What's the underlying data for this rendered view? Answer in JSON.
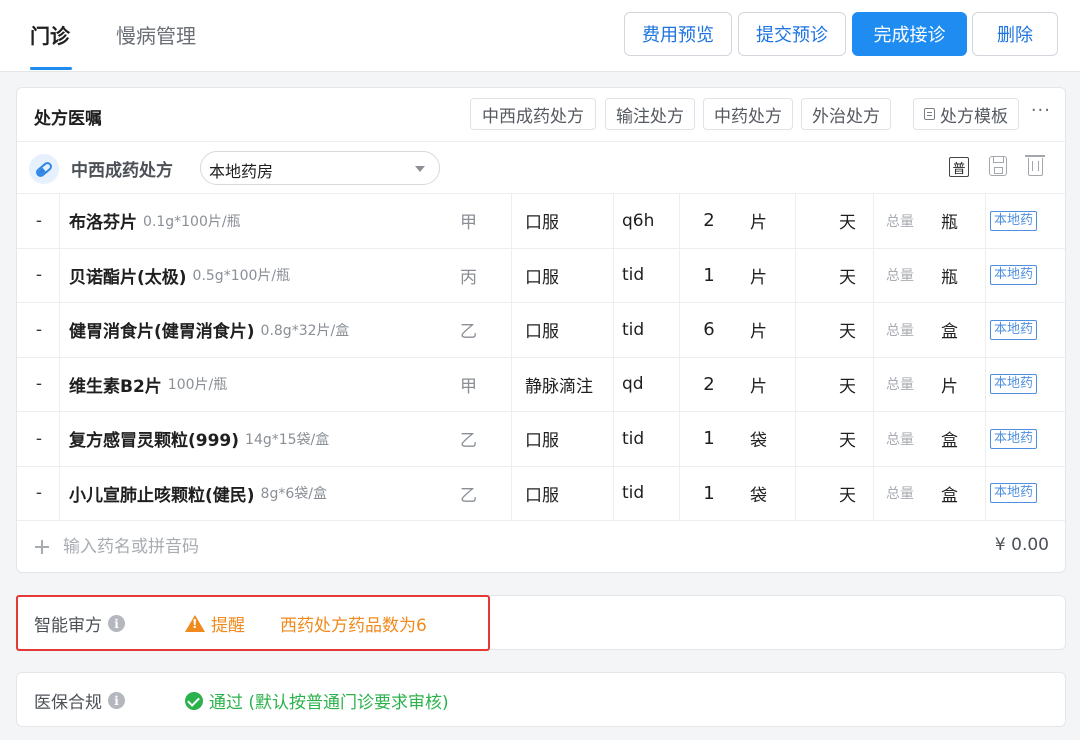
{
  "tabs": {
    "active": "门诊",
    "inactive": "慢病管理"
  },
  "toolbar": {
    "cost_preview": "费用预览",
    "submit_precheck": "提交预诊",
    "finish_visit": "完成接诊",
    "delete": "删除"
  },
  "rx": {
    "title": "处方医嘱",
    "types": [
      "中西成药处方",
      "输注处方",
      "中药处方",
      "外治处方"
    ],
    "template_label": "处方模板",
    "more": "···",
    "sub_title": "中西成药处方",
    "pharmacy": "本地药房",
    "pu_badge": "普",
    "rows": [
      {
        "dash": "-",
        "name": "布洛芬片",
        "spec": "0.1g*100片/瓶",
        "grade": "甲",
        "route": "口服",
        "freq": "q6h",
        "qty": "2",
        "unit": "片",
        "days": "天",
        "total": "总量",
        "pack": "瓶",
        "tag": "本地药"
      },
      {
        "dash": "-",
        "name": "贝诺酯片(太极)",
        "spec": "0.5g*100片/瓶",
        "grade": "丙",
        "route": "口服",
        "freq": "tid",
        "qty": "1",
        "unit": "片",
        "days": "天",
        "total": "总量",
        "pack": "瓶",
        "tag": "本地药"
      },
      {
        "dash": "-",
        "name": "健胃消食片(健胃消食片)",
        "spec": "0.8g*32片/盒",
        "grade": "乙",
        "route": "口服",
        "freq": "tid",
        "qty": "6",
        "unit": "片",
        "days": "天",
        "total": "总量",
        "pack": "盒",
        "tag": "本地药"
      },
      {
        "dash": "-",
        "name": "维生素B2片",
        "spec": "100片/瓶",
        "grade": "甲",
        "route": "静脉滴注",
        "freq": "qd",
        "qty": "2",
        "unit": "片",
        "days": "天",
        "total": "总量",
        "pack": "片",
        "tag": "本地药"
      },
      {
        "dash": "-",
        "name": "复方感冒灵颗粒(999)",
        "spec": "14g*15袋/盒",
        "grade": "乙",
        "route": "口服",
        "freq": "tid",
        "qty": "1",
        "unit": "袋",
        "days": "天",
        "total": "总量",
        "pack": "盒",
        "tag": "本地药"
      },
      {
        "dash": "-",
        "name": "小儿宣肺止咳颗粒(健民)",
        "spec": "8g*6袋/盒",
        "grade": "乙",
        "route": "口服",
        "freq": "tid",
        "qty": "1",
        "unit": "袋",
        "days": "天",
        "total": "总量",
        "pack": "盒",
        "tag": "本地药"
      }
    ],
    "add_placeholder": "输入药名或拼音码",
    "total_price": "¥ 0.00"
  },
  "review": {
    "label": "智能审方",
    "level": "提醒",
    "message": "西药处方药品数为6"
  },
  "compliance": {
    "label": "医保合规",
    "status": "通过 (默认按普通门诊要求审核)"
  },
  "colors": {
    "accent": "#1e8cf0",
    "warning": "#f08a1c",
    "success": "#2bb24c",
    "highlight": "#e53935"
  }
}
